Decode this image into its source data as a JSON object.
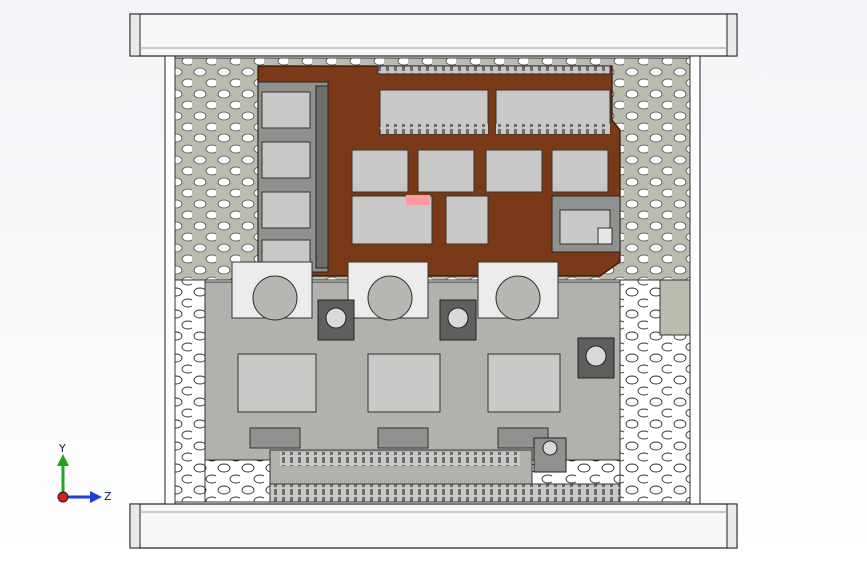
{
  "viewport": {
    "background_color": "#ffffff",
    "model": "pcb-shield-assembly-in-perforated-enclosure"
  },
  "triad": {
    "y_label": "Y",
    "z_label": "Z",
    "colors": {
      "y": "#1fa51f",
      "z": "#1f3fd6",
      "x": "#d41f1f"
    }
  },
  "colors": {
    "frame": "#f7f7f7",
    "perforated_plate": "#b9bdb0",
    "pcb": "#7a3a18",
    "component_gray": "#8f918e",
    "highlight": "#ff9aa0"
  }
}
